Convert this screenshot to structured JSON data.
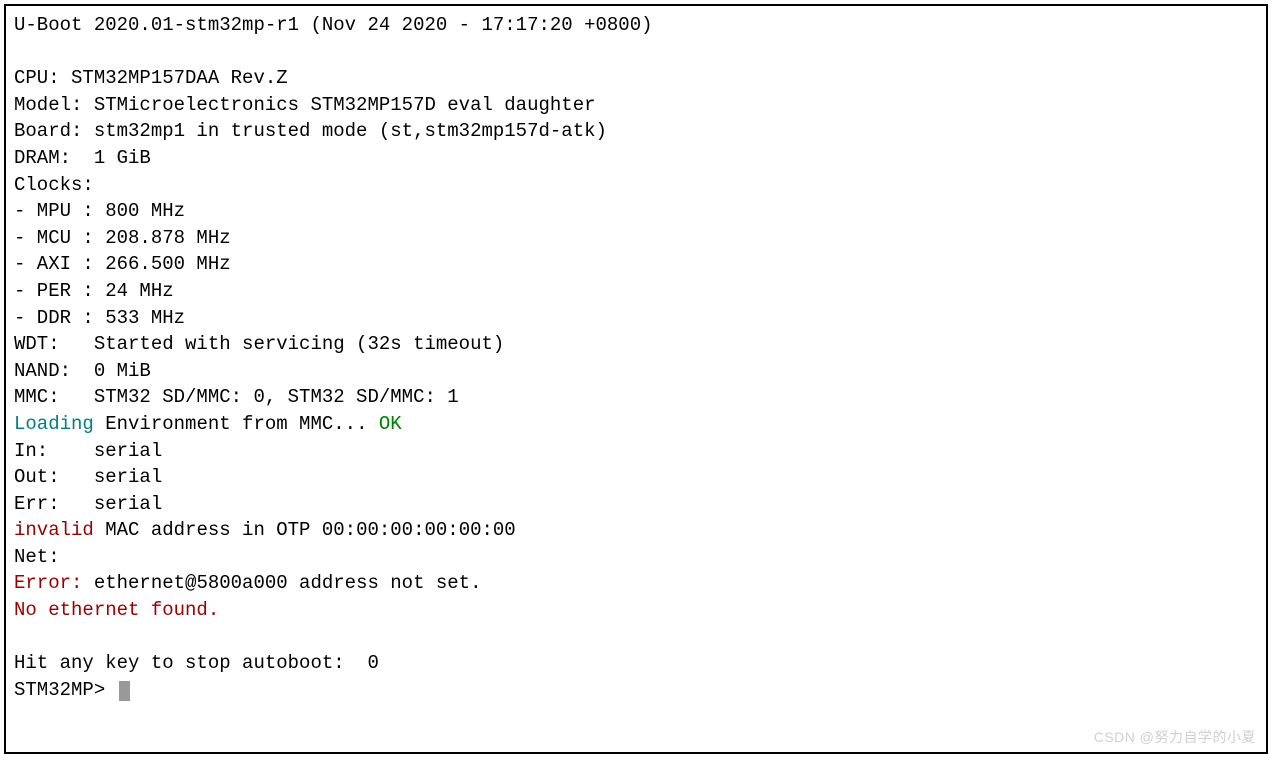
{
  "header": "U-Boot 2020.01-stm32mp-r1 (Nov 24 2020 - 17:17:20 +0800)",
  "cpu": "CPU: STM32MP157DAA Rev.Z",
  "model": "Model: STMicroelectronics STM32MP157D eval daughter",
  "board": "Board: stm32mp1 in trusted mode (st,stm32mp157d-atk)",
  "dram": "DRAM:  1 GiB",
  "clocks_header": "Clocks:",
  "clock_mpu": "- MPU : 800 MHz",
  "clock_mcu": "- MCU : 208.878 MHz",
  "clock_axi": "- AXI : 266.500 MHz",
  "clock_per": "- PER : 24 MHz",
  "clock_ddr": "- DDR : 533 MHz",
  "wdt": "WDT:   Started with servicing (32s timeout)",
  "nand": "NAND:  0 MiB",
  "mmc": "MMC:   STM32 SD/MMC: 0, STM32 SD/MMC: 1",
  "loading_prefix": "Loading",
  "loading_mid": " Environment from MMC... ",
  "loading_ok": "OK",
  "in": "In:    serial",
  "out": "Out:   serial",
  "err": "Err:   serial",
  "invalid_prefix": "invalid",
  "invalid_rest": " MAC address in OTP 00:00:00:00:00:00",
  "net": "Net:   ",
  "error_prefix": "Error:",
  "error_rest": " ethernet@5800a000 address not set.",
  "no_eth": "No ethernet found.",
  "autoboot": "Hit any key to stop autoboot:  0",
  "prompt": "STM32MP> ",
  "watermark": "CSDN @努力自学的小夏"
}
